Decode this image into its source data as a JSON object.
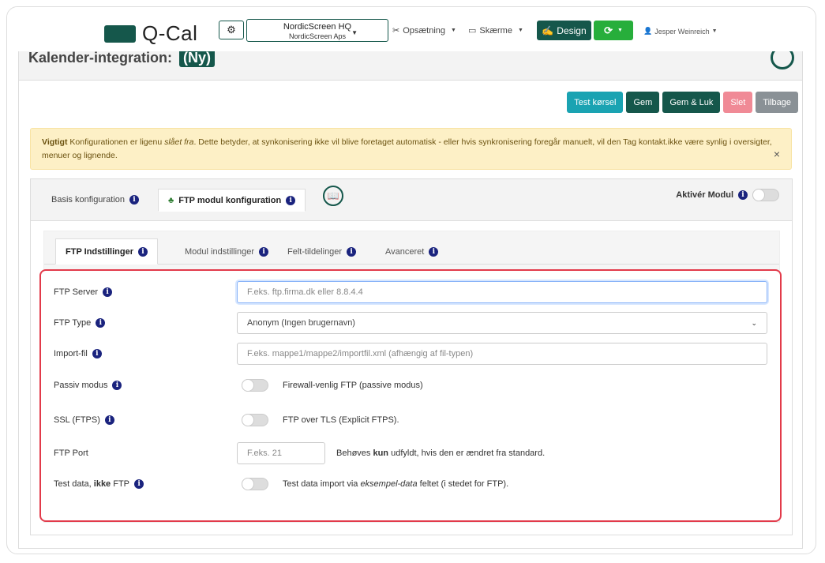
{
  "nav": {
    "brand": "Q-Cal",
    "org_name": "NordicScreen HQ",
    "org_sub": "NordicScreen Aps",
    "setup_label": "Opsætning",
    "screens_label": "Skærme",
    "design_label": "Design",
    "user_name": "Jesper Weinreich"
  },
  "page": {
    "title": "Kalender-integration:",
    "new_badge": "(Ny)"
  },
  "actions": {
    "test": "Test kørsel",
    "save": "Gem",
    "save_close": "Gem & Luk",
    "delete": "Slet",
    "back": "Tilbage"
  },
  "alert": {
    "strong": "Vigtigt",
    "text1": " Konfigurationen er ligenu ",
    "em": "slået fra",
    "text2": ". Dette betyder, at synkonisering ikke vil blive foretaget automatisk - eller hvis synkronisering foregår manuelt, vil den Tag kontakt.ikke være synlig i oversigter, menuer og lignende.",
    "close": "×"
  },
  "module_tabs": {
    "basis": "Basis konfiguration",
    "ftp": "FTP modul konfiguration",
    "activate": "Aktivér Modul"
  },
  "inner_tabs": {
    "ftp_settings": "FTP Indstillinger",
    "module_settings": "Modul indstillinger",
    "field_mapping": "Felt-tildelinger",
    "advanced": "Avanceret"
  },
  "form": {
    "server_label": "FTP Server",
    "server_placeholder": "F.eks. ftp.firma.dk eller 8.8.4.4",
    "type_label": "FTP Type",
    "type_value": "Anonym (Ingen brugernavn)",
    "import_label": "Import-fil",
    "import_placeholder": "F.eks. mappe1/mappe2/importfil.xml (afhængig af fil-typen)",
    "passive_label": "Passiv modus",
    "passive_desc": "Firewall-venlig FTP (passive modus)",
    "ssl_label": "SSL (FTPS)",
    "ssl_desc": "FTP over TLS (Explicit FTPS).",
    "port_label": "FTP Port",
    "port_placeholder": "F.eks. 21",
    "port_desc1": "Behøves ",
    "port_desc_bold": "kun",
    "port_desc2": " udfyldt, hvis den er ændret fra standard.",
    "test_label1": "Test data, ",
    "test_label_bold": "ikke",
    "test_label2": " FTP",
    "test_desc1": "Test data import via ",
    "test_desc_em": "eksempel-data",
    "test_desc2": " feltet (i stedet for FTP)."
  },
  "colors": {
    "brand": "#15574b",
    "green": "#27ae3b",
    "teal": "#1aa3b2",
    "danger": "#e23a4a",
    "alert_bg": "#fdf0c6"
  }
}
